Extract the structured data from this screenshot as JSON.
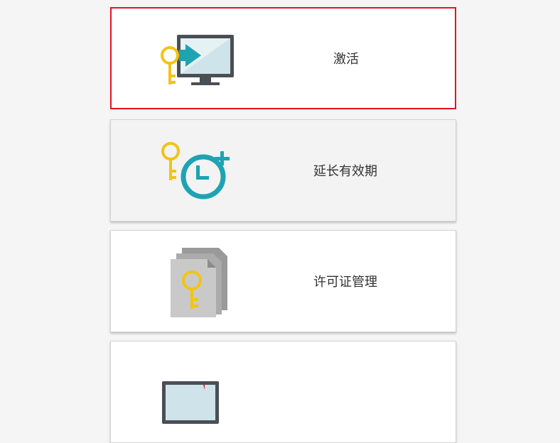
{
  "menu": {
    "items": [
      {
        "label": "激活",
        "icon": "key-monitor-icon",
        "state": "selected"
      },
      {
        "label": "延长有效期",
        "icon": "key-clock-plus-icon",
        "state": "hover"
      },
      {
        "label": "许可证管理",
        "icon": "key-documents-icon",
        "state": "normal"
      },
      {
        "label": "",
        "icon": "monitor-icon",
        "state": "normal"
      }
    ]
  },
  "colors": {
    "selected_border": "#e3141e",
    "key": "#f2c414",
    "teal": "#1ea3b2",
    "monitor_frame": "#4a4f55"
  }
}
